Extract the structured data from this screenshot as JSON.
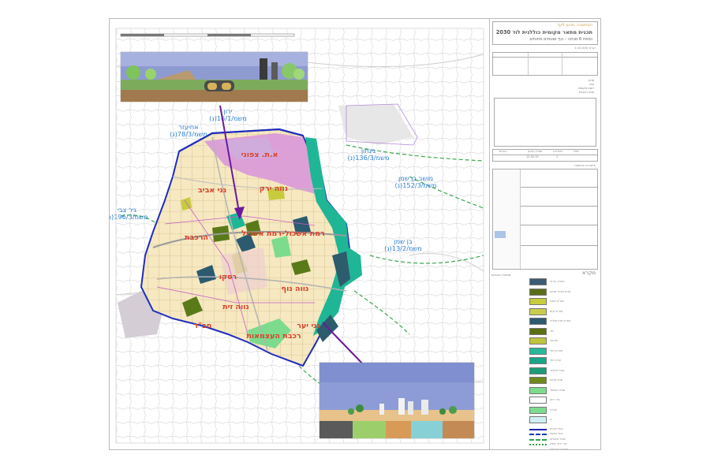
{
  "sheet_title": {
    "line1": "תכנית מתאר מקומית כוללנית לוד 2030",
    "line2": "נספח 6 מנחה – נוף ושטחים פתוחים",
    "scale": "קנ\"מ 1:10,000",
    "header_band": "המחשבה, תכנון ליעד"
  },
  "neighborhoods": [
    {
      "id": "old-city",
      "label": "א.ת. צפוני",
      "color": "#c0392b"
    },
    {
      "id": "ganey-aviv",
      "label": "גני אביב",
      "color": "#c0392b"
    },
    {
      "id": "neve-yarak",
      "label": "נווה ירק",
      "color": "#c0392b"
    },
    {
      "id": "railway",
      "label": "הרכבת",
      "color": "#c0392b"
    },
    {
      "id": "shikun-rakevet",
      "label": "רמת אשכול-רמת אשכול",
      "color": "#c0392b"
    },
    {
      "id": "ramle",
      "label": "רסקו",
      "color": "#c0392b"
    },
    {
      "id": "neve-nof",
      "label": "נווה נוף",
      "color": "#c0392b"
    },
    {
      "id": "neve-zait",
      "label": "נווה זית",
      "color": "#c0392b"
    },
    {
      "id": "habad",
      "label": "חב\"ד",
      "color": "#c0392b"
    },
    {
      "id": "ganey-yaar",
      "label": "גני יער",
      "color": "#c0392b"
    },
    {
      "id": "rishon",
      "label": "רכבת העצמאות",
      "color": "#c0392b"
    }
  ],
  "external_labels": [
    {
      "name": "ירון",
      "code": "משמ/16/1(נ)"
    },
    {
      "name": "אחיעזר",
      "code": "משמ/78/3(נ)"
    },
    {
      "name": "גינתון",
      "code": "משמ/136/3(נ)"
    },
    {
      "name": "מושב בן שמן",
      "code": "משמ/152/3(נ)"
    },
    {
      "name": "גיר צבי",
      "code": "משמ/196/3(נ)"
    },
    {
      "name": "בן שמן",
      "code": "משמ/13/2(נ)"
    }
  ],
  "legend": {
    "title": "מקרא",
    "small_legend_title": "מפתח הגבהים",
    "items": [
      {
        "label": "פארק עירוני",
        "color": "#3b5b73"
      },
      {
        "label": "שטח ציבורי פתוח",
        "color": "#5a6e18"
      },
      {
        "label": "שצ\"פ מוצע",
        "color": "#c7cb3e"
      },
      {
        "label": "שצ\"פ קיים",
        "color": "#cacc4e"
      },
      {
        "label": "פארק מטרופוליני",
        "color": "#2c5a6f"
      },
      {
        "label": "יער",
        "color": "#5b6f14"
      },
      {
        "label": "חורשה",
        "color": "#bfc43c"
      },
      {
        "label": "פארק נחל",
        "color": "#29b89a"
      },
      {
        "label": "ערוץ נחל",
        "color": "#1aa488"
      },
      {
        "label": "שטח חקלאי",
        "color": "#1d9a7a"
      },
      {
        "label": "שטח פתוח",
        "color": "#6f8a1c"
      },
      {
        "label": "שטח לשימור",
        "color": "#7ddb8e"
      },
      {
        "label": "ציר ירוק",
        "color": "#ffffff"
      },
      {
        "label": "שדרה",
        "color": "#7ddb8e"
      },
      {
        "label": "גן",
        "color": "#cfeff2"
      }
    ],
    "line_items": [
      {
        "label": "גבול תכנית",
        "color": "#2222bb",
        "style": "solid"
      },
      {
        "label": "גבול שיפוט",
        "color": "#1a3aa8",
        "style": "dashed"
      },
      {
        "label": "שביל אופניים",
        "color": "#2aa64a",
        "style": "dashed"
      },
      {
        "label": "ציר ירוק מוצע",
        "color": "#2aa64a",
        "style": "dotted"
      },
      {
        "label": "מסדרון אקולוגי",
        "color": "#9fd39f",
        "style": "solid"
      }
    ]
  },
  "info_table": {
    "header": [
      "שלב",
      "מהדורה",
      "תאריך עדכון",
      "הערות"
    ],
    "row": [
      "",
      "1",
      "12.05.15",
      ""
    ]
  },
  "approvals_title": "אישורים וחתימות"
}
